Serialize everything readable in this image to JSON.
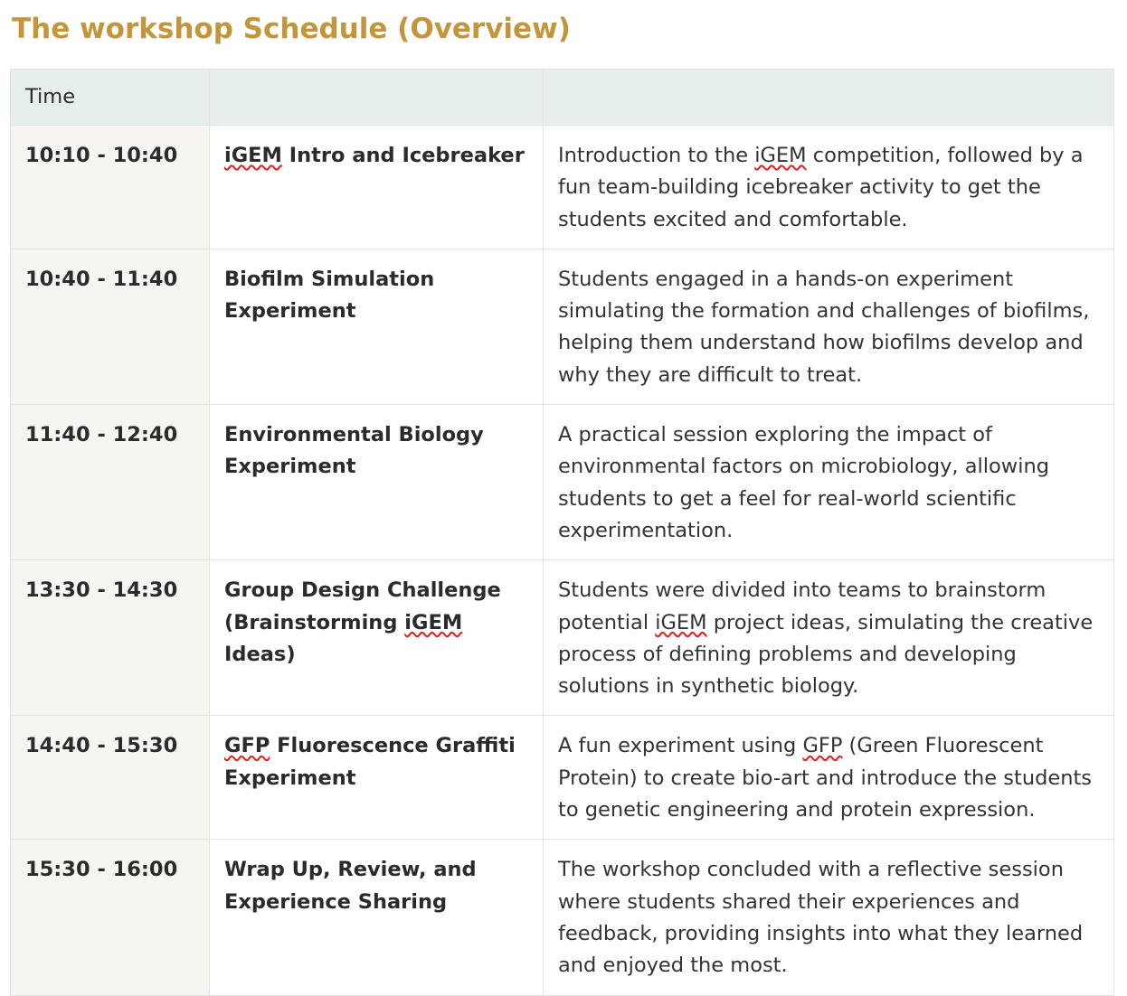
{
  "page": {
    "title": "The workshop Schedule (Overview)"
  },
  "colors": {
    "title": "#c4963c",
    "header_bg": "#e6efe9",
    "time_column_bg": "#f6f5f1",
    "border": "#e2e2e2",
    "spellcheck_underline": "#e02020"
  },
  "table": {
    "headers": [
      "Time",
      "",
      ""
    ],
    "rows": [
      {
        "time": "10:10 - 10:40",
        "activity": [
          "iGEM",
          " Intro and Icebreaker"
        ],
        "description": [
          "Introduction to the ",
          "iGEM",
          " competition, followed by a fun team-building icebreaker activity to get the students excited and comfortable."
        ]
      },
      {
        "time": "10:40 - 11:40",
        "activity": [
          "Biofilm Simulation Experiment"
        ],
        "description": [
          "Students engaged in a hands-on experiment simulating the formation and challenges of biofilms, helping them understand how biofilms develop and why they are difficult to treat."
        ]
      },
      {
        "time": "11:40 - 12:40",
        "activity": [
          "Environmental Biology Experiment"
        ],
        "description": [
          "A practical session exploring the impact of environmental factors on microbiology, allowing students to get a feel for real-world scientific experimentation."
        ]
      },
      {
        "time": "13:30 - 14:30",
        "activity": [
          "Group Design Challenge (Brainstorming ",
          "iGEM",
          " Ideas)"
        ],
        "description": [
          "Students were divided into teams to brainstorm potential ",
          "iGEM",
          " project ideas, simulating the creative process of defining problems and developing solutions in synthetic biology."
        ]
      },
      {
        "time": "14:40 - 15:30",
        "activity": [
          "GFP",
          " Fluorescence Graffiti Experiment"
        ],
        "description": [
          "A fun experiment using ",
          "GFP",
          " (Green Fluorescent Protein) to create bio-art and introduce the students to genetic engineering and protein expression."
        ]
      },
      {
        "time": "15:30 - 16:00",
        "activity": [
          "Wrap Up, Review, and Experience Sharing"
        ],
        "description": [
          "The workshop concluded with a reflective session where students shared their experiences and feedback, providing insights into what they learned and enjoyed the most."
        ]
      }
    ]
  }
}
